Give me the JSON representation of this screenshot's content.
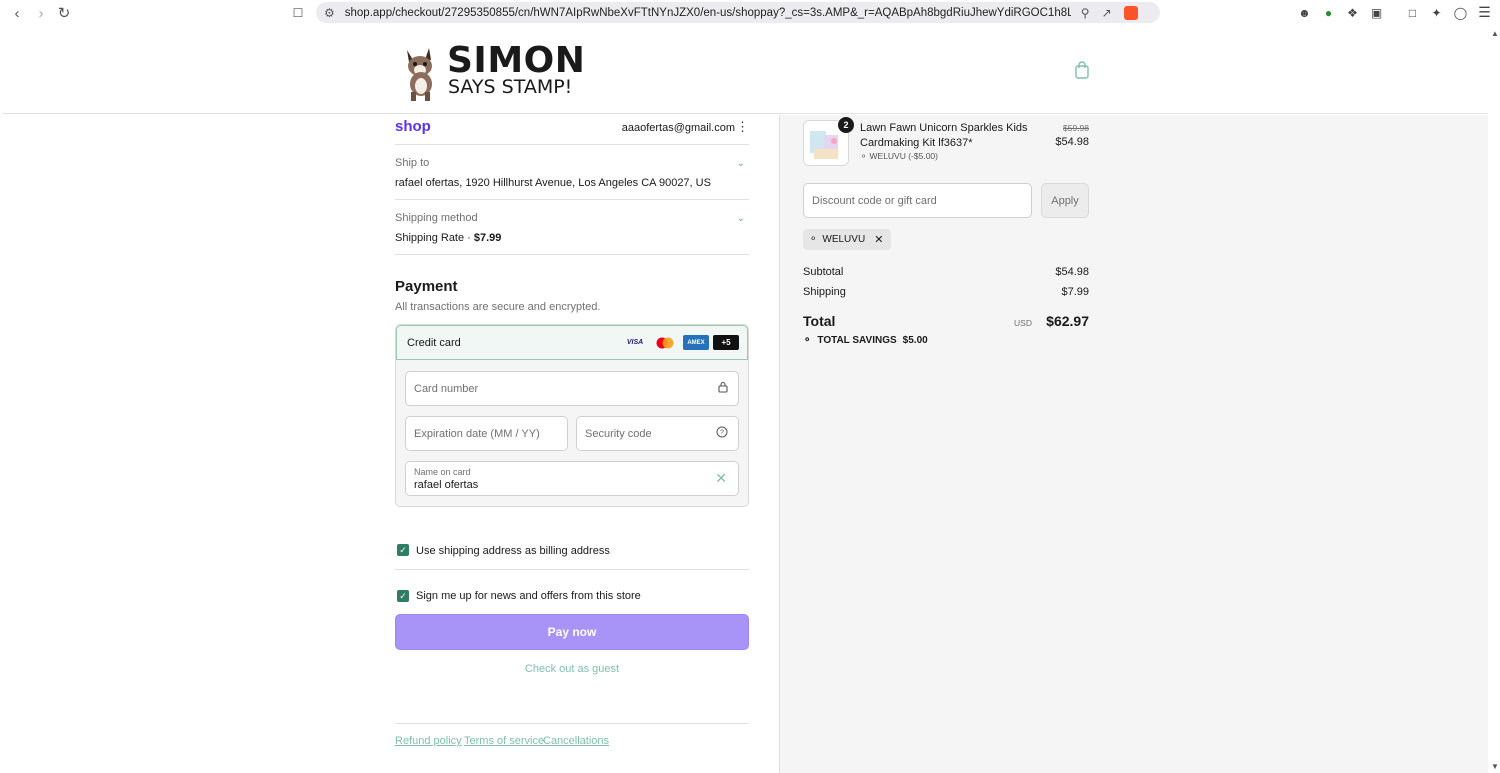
{
  "browser": {
    "url": "shop.app/checkout/27295350855/cn/hWN7AIpRwNbeXvFTtNYnJZX0/en-us/shoppay?_cs=3s.AMP&_r=AQABpAh8bgdRiuJhewYdiRGOC1h8L3-LO0Tie..."
  },
  "store": {
    "name_line1": "SIMON",
    "name_line2": "SAYS STAMP!"
  },
  "account": {
    "shop_logo": "shop",
    "email": "aaaofertas@gmail.com"
  },
  "ship_to": {
    "label": "Ship to",
    "value": "rafael ofertas, 1920 Hillhurst Avenue, Los Angeles CA 90027, US"
  },
  "shipping_method": {
    "label": "Shipping method",
    "name": "Shipping Rate · ",
    "price": "$7.99"
  },
  "payment": {
    "title": "Payment",
    "subtitle": "All transactions are secure and encrypted.",
    "method_label": "Credit card",
    "card_brands": [
      "VISA",
      "mastercard",
      "AMEX",
      "+5"
    ],
    "card_number_placeholder": "Card number",
    "expiry_placeholder": "Expiration date (MM / YY)",
    "security_placeholder": "Security code",
    "name_label": "Name on card",
    "name_value": "rafael ofertas"
  },
  "options": {
    "billing_same": "Use shipping address as billing address",
    "newsletter": "Sign me up for news and offers from this store"
  },
  "actions": {
    "pay_now": "Pay now",
    "guest": "Check out as guest"
  },
  "footer": {
    "links": [
      "Refund policy",
      "Terms of service",
      "Cancellations"
    ]
  },
  "order": {
    "quantity": "2",
    "product_name": "Lawn Fawn Unicorn Sparkles Kids Cardmaking Kit lf3637*",
    "product_discount": "WELUVU (-$5.00)",
    "price_original": "$59.98",
    "price_current": "$54.98",
    "discount_placeholder": "Discount code or gift card",
    "apply_label": "Apply",
    "applied_code": "WELUVU",
    "subtotal_label": "Subtotal",
    "subtotal_value": "$54.98",
    "shipping_label": "Shipping",
    "shipping_value": "$7.99",
    "total_label": "Total",
    "currency": "USD",
    "total_value": "$62.97",
    "savings_label": "TOTAL SAVINGS",
    "savings_value": "$5.00"
  },
  "colors": {
    "shop_purple": "#5a31f4",
    "pay_button": "#a894f6",
    "check_green": "#2e7d64"
  }
}
